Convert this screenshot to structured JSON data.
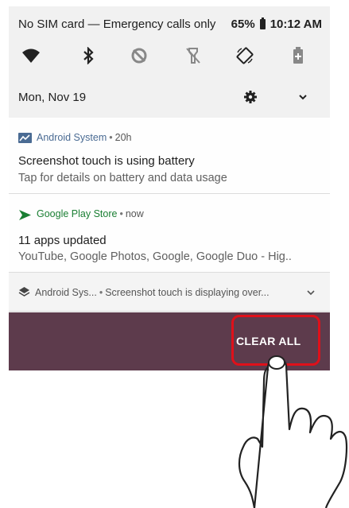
{
  "status_bar": {
    "left_text": "No SIM card — Emergency calls only",
    "battery_percent": "65%",
    "time": "10:12 AM"
  },
  "quick_settings": {
    "icons": [
      "wifi-icon",
      "bluetooth-icon",
      "do-not-disturb-icon",
      "flashlight-off-icon",
      "auto-rotate-icon",
      "battery-saver-icon"
    ]
  },
  "date_row": {
    "date": "Mon, Nov 19"
  },
  "notifications": [
    {
      "app": "Android System",
      "separator": "•",
      "time": "20h",
      "title": "Screenshot touch is using battery",
      "body": "Tap for details on battery and data usage"
    },
    {
      "app": "Google Play Store",
      "separator": "•",
      "time": "now",
      "title": "11 apps updated",
      "body": "YouTube, Google Photos, Google, Google Duo - Hig.."
    },
    {
      "app": "Android Sys...",
      "separator": "•",
      "text": "Screenshot touch is displaying over..."
    }
  ],
  "bottom_bar": {
    "clear_all_label": "CLEAR ALL"
  },
  "colors": {
    "bottom_bar": "#5d3b4c",
    "highlight": "#e0101a",
    "play_store": "#1a7f33",
    "android_system": "#4a6b93"
  }
}
